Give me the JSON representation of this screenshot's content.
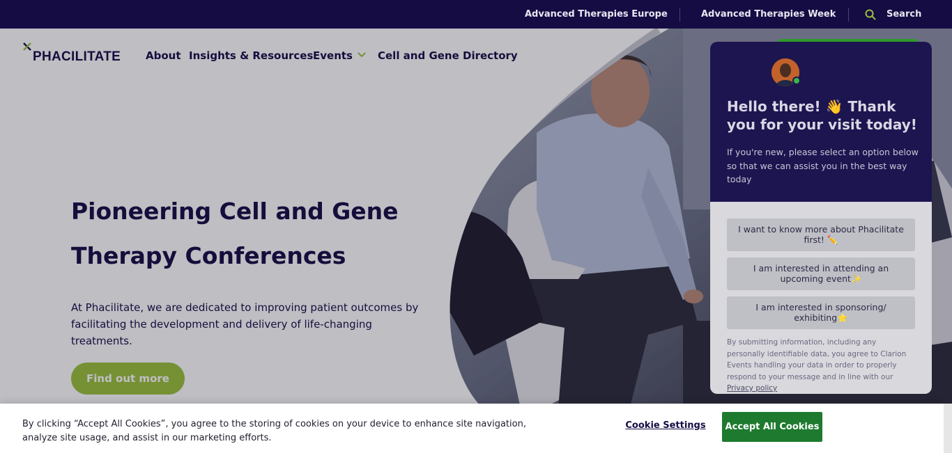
{
  "topbar": {
    "link_europe": "Advanced Therapies Europe",
    "link_week": "Advanced Therapies Week",
    "search_label": "Search"
  },
  "logo": {
    "text": "PHACILITATE"
  },
  "nav": {
    "about": "About",
    "insights": "Insights & Resources",
    "events": "Events",
    "directory": "Cell and Gene Directory"
  },
  "hero": {
    "title": "Pioneering Cell and Gene Therapy Conferences",
    "description": "At Phacilitate, we are dedicated to improving patient outcomes by facilitating the development and delivery of life-changing treatments.",
    "cta": "Find out more"
  },
  "chat": {
    "title": "Hello there! 👋 Thank you for your visit today!",
    "subtitle": "If you're new, please select an option below so that we can assist you in the best way today",
    "options": [
      "I want to know more about Phacilitate first! ✏️",
      "I am interested in attending an upcoming event✨",
      "I am interested in sponsoring/ exhibiting⭐"
    ],
    "legal_prefix": "By submitting information, including any personally identifiable data, you agree to Clarion Events handling your data in order to properly respond to your message and in line with our ",
    "privacy_link": "Privacy policy"
  },
  "cookie": {
    "text": "By clicking “Accept All Cookies”, you agree to the storing of cookies on your device to enhance site navigation, analyze site usage, and assist in our marketing efforts.",
    "settings": "Cookie Settings",
    "accept": "Accept All Cookies"
  },
  "colors": {
    "navy": "#150c44",
    "lime": "#9bc03a",
    "green": "#1d7a2e",
    "chat_head": "#1d1550"
  },
  "icons": [
    "search-icon",
    "chevron-down-icon",
    "logo-mark-icon",
    "online-status-icon"
  ]
}
